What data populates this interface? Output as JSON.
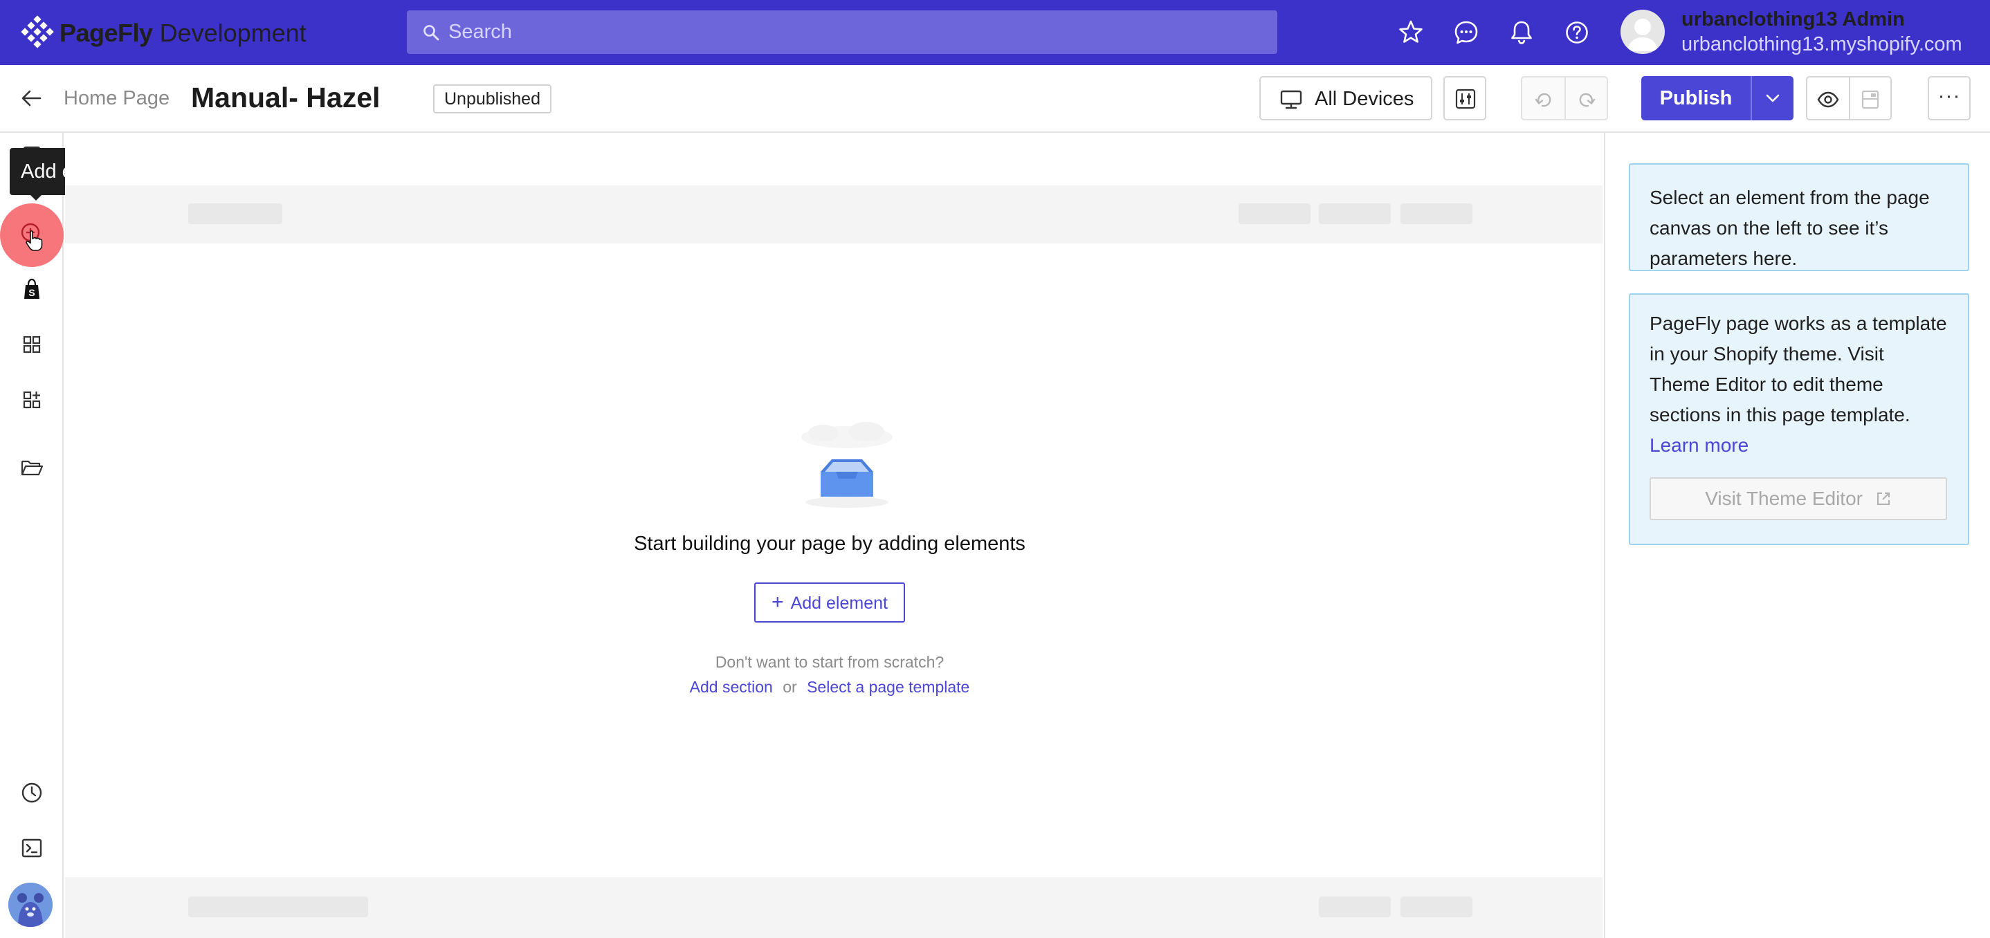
{
  "topbar": {
    "brand_name": "PageFly",
    "brand_env": "Development",
    "search_placeholder": "Search",
    "user_name": "urbanclothing13 Admin",
    "user_domain": "urbanclothing13.myshopify.com",
    "icons": [
      "star-icon",
      "chat-icon",
      "bell-icon",
      "help-icon"
    ],
    "bg_color": "#3c31c9"
  },
  "editor_bar": {
    "back_label": "Home Page",
    "page_title": "Manual- Hazel",
    "status": "Unpublished",
    "devices_label": "All Devices",
    "publish_label": "Publish",
    "more_label": "···",
    "accent_color": "#4b46d6"
  },
  "sidebar": {
    "tooltip": "Add element",
    "icons": [
      "pages-icon",
      "add-element-icon",
      "shopify-icon",
      "layout-grid-icon",
      "add-widget-icon",
      "folder-icon",
      "history-icon",
      "terminal-icon",
      "mascot-avatar"
    ]
  },
  "canvas": {
    "empty_title": "Start building your page by adding elements",
    "add_element_label": "Add element",
    "scratch_text": "Don't want to start from scratch?",
    "add_section_label": "Add section",
    "or_label": "or",
    "template_label": "Select a page template"
  },
  "right_panel": {
    "select_hint": "Select an element from the page canvas on the left to see it’s parameters here.",
    "theme_info": "PageFly page works as a template in your Shopify theme. Visit Theme Editor to edit theme sections in this page template.",
    "learn_more_label": "Learn more",
    "visit_theme_label": "Visit Theme Editor"
  }
}
